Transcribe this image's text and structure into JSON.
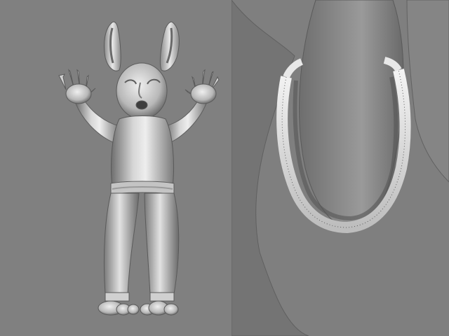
{
  "scene": {
    "background_color": "#808080",
    "surface_color": "#c8c8c8",
    "shadow_color": "#5a5a5a",
    "highlight_color": "#f2f2f2"
  },
  "panels": [
    {
      "subject": "bunny-figure-full-body"
    },
    {
      "subject": "leg-closeup-with-trouser-cuff"
    }
  ]
}
